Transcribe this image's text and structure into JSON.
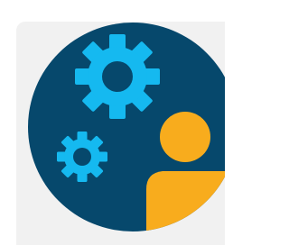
{
  "illustration": {
    "name": "admin-user-settings",
    "icons": [
      "gear-icon-large",
      "gear-icon-small",
      "user-icon"
    ]
  },
  "colors": {
    "panel": "#f1f1f1",
    "circle": "#06486c",
    "gear": "#15b9f0",
    "user": "#f8ac1d",
    "background": "#ffffff"
  }
}
